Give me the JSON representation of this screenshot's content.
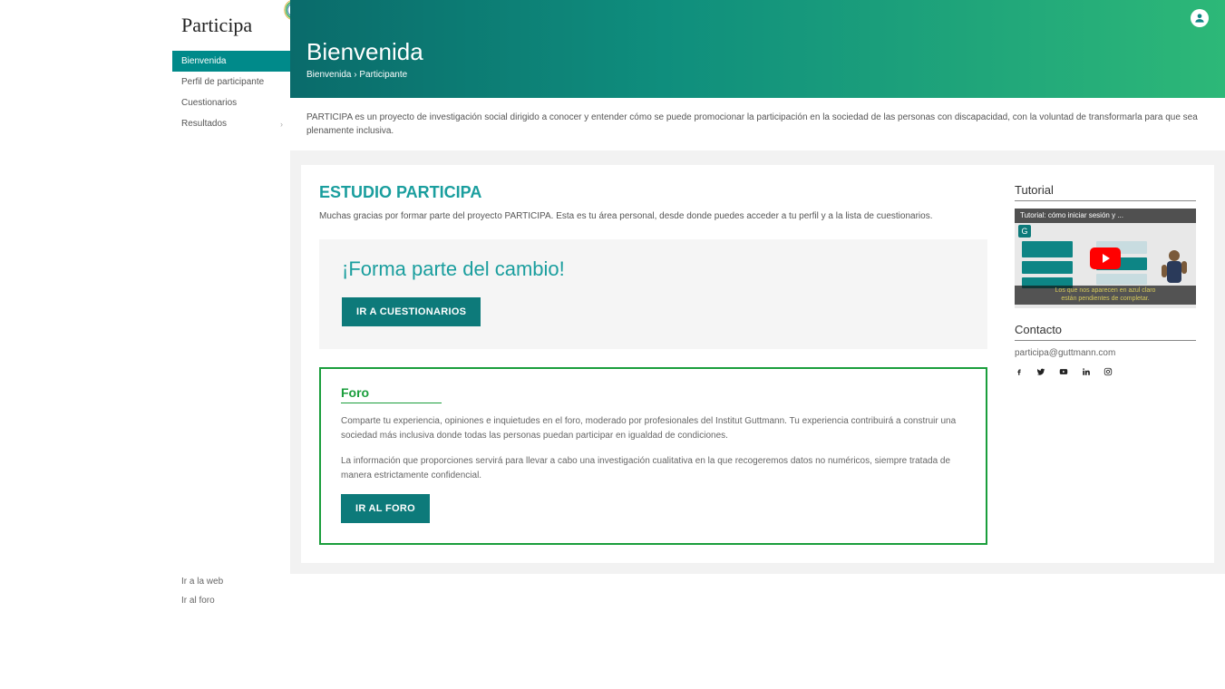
{
  "brand": "Participa",
  "sidebar": {
    "items": [
      {
        "label": "Bienvenida",
        "active": true
      },
      {
        "label": "Perfil de participante",
        "active": false
      },
      {
        "label": "Cuestionarios",
        "active": false
      },
      {
        "label": "Resultados",
        "active": false,
        "has_chevron": true
      }
    ],
    "bottom": [
      {
        "label": "Ir a la web"
      },
      {
        "label": "Ir al foro"
      }
    ]
  },
  "header": {
    "title": "Bienvenida",
    "breadcrumb1": "Bienvenida",
    "breadcrumb2": "Participante"
  },
  "intro": "PARTICIPA es un proyecto de investigación social dirigido a conocer y entender cómo se puede promocionar la participación en la sociedad de las personas con discapacidad, con la voluntad de transformarla para que sea plenamente inclusiva.",
  "study": {
    "title": "ESTUDIO PARTICIPA",
    "intro": "Muchas gracias por formar parte del proyecto PARTICIPA. Esta es tu área personal, desde donde puedes acceder a tu perfil y a la lista de cuestionarios."
  },
  "cta": {
    "title": "¡Forma parte del cambio!",
    "button": "IR A CUESTIONARIOS"
  },
  "foro": {
    "title": "Foro",
    "p1": "Comparte tu experiencia, opiniones e inquietudes en el foro, moderado por profesionales del Institut Guttmann. Tu experiencia contribuirá a construir una sociedad más inclusiva donde todas las personas puedan participar en igualdad de condiciones.",
    "p2": "La información que proporciones servirá para llevar a cabo una investigación cualitativa en la que recogeremos datos no numéricos, siempre tratada de manera estrictamente confidencial.",
    "button": "IR AL FORO"
  },
  "tutorial": {
    "title": "Tutorial",
    "video_title": "Tutorial: cómo iniciar sesión y ...",
    "caption1": "Los que nos aparecen en azul claro",
    "caption2": "están pendientes de completar."
  },
  "contact": {
    "title": "Contacto",
    "email": "participa@guttmann.com"
  },
  "icons": {
    "facebook": "f",
    "twitter": "t",
    "youtube": "y",
    "linkedin": "in",
    "instagram": "ig"
  }
}
